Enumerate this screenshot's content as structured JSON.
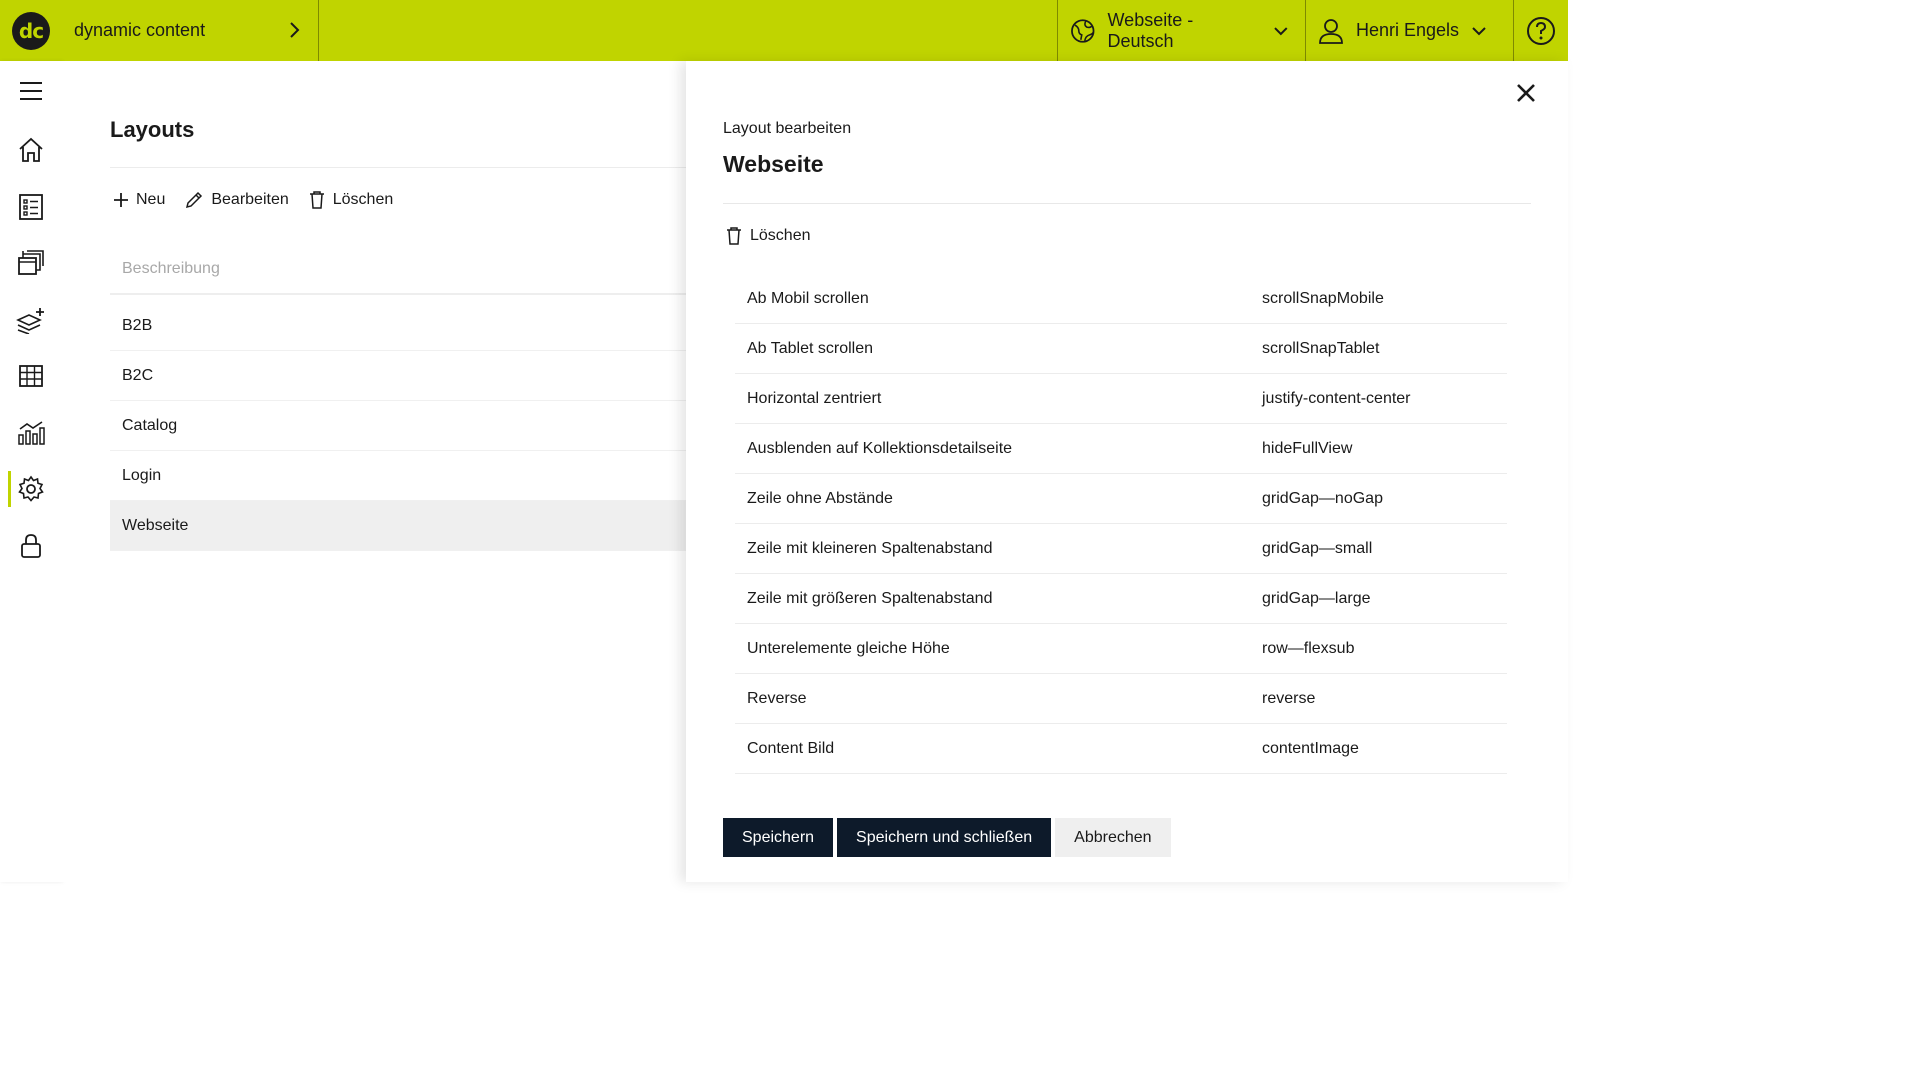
{
  "header": {
    "logo_text": "dc",
    "app_name": "dynamic content",
    "language": "Webseite - Deutsch",
    "user": "Henri Engels",
    "accent_color": "#c0d400"
  },
  "sidebar": {
    "items": [
      {
        "icon": "menu-icon"
      },
      {
        "icon": "home-icon"
      },
      {
        "icon": "list-icon"
      },
      {
        "icon": "windows-icon"
      },
      {
        "icon": "layers-add-icon"
      },
      {
        "icon": "grid-icon"
      },
      {
        "icon": "analytics-icon"
      },
      {
        "icon": "gear-icon",
        "active": true
      },
      {
        "icon": "lock-icon"
      }
    ]
  },
  "main": {
    "title": "Layouts",
    "toolbar": {
      "new_label": "Neu",
      "edit_label": "Bearbeiten",
      "delete_label": "Löschen"
    },
    "column_header": "Beschreibung",
    "items": [
      "B2B",
      "B2C",
      "Catalog",
      "Login",
      "Webseite"
    ],
    "selected": "Webseite"
  },
  "panel": {
    "subtitle": "Layout bearbeiten",
    "title": "Webseite",
    "delete_label": "Löschen",
    "properties": [
      {
        "label": "Ab Mobil scrollen",
        "value": "scrollSnapMobile"
      },
      {
        "label": "Ab Tablet scrollen",
        "value": "scrollSnapTablet"
      },
      {
        "label": "Horizontal zentriert",
        "value": "justify-content-center"
      },
      {
        "label": "Ausblenden auf Kollektionsdetailseite",
        "value": "hideFullView"
      },
      {
        "label": "Zeile ohne Abstände",
        "value": "gridGap—noGap"
      },
      {
        "label": "Zeile mit kleineren Spaltenabstand",
        "value": "gridGap—small"
      },
      {
        "label": "Zeile mit größeren Spaltenabstand",
        "value": "gridGap—large"
      },
      {
        "label": "Unterelemente gleiche Höhe",
        "value": "row—flexsub"
      },
      {
        "label": "Reverse",
        "value": "reverse"
      },
      {
        "label": "Content Bild",
        "value": "contentImage"
      }
    ],
    "buttons": {
      "save": "Speichern",
      "save_close": "Speichern und schließen",
      "cancel": "Abbrechen"
    }
  }
}
